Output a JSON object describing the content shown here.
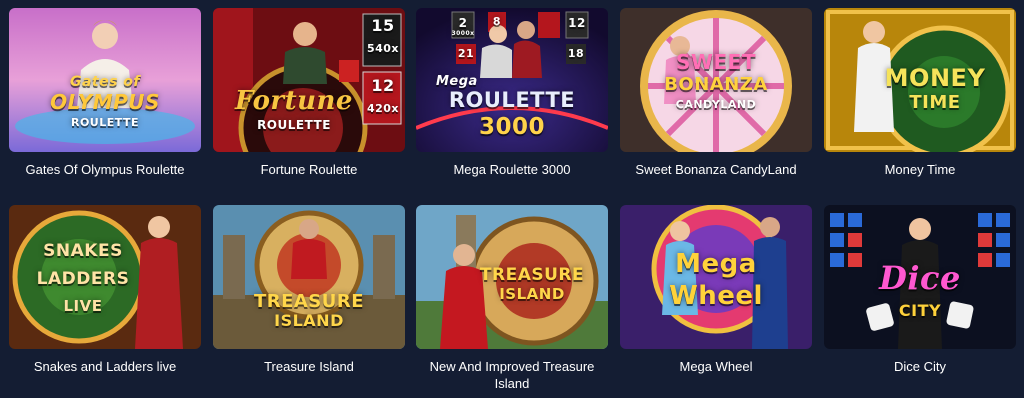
{
  "games": [
    {
      "title": "Gates Of Olympus Roulette",
      "logo": [
        "Gates of",
        "OLYMPUS",
        "ROULETTE"
      ]
    },
    {
      "title": "Fortune Roulette",
      "logo": [
        "Fortune",
        "ROULETTE"
      ],
      "multipliers": [
        "15",
        "540x",
        "12",
        "420x"
      ]
    },
    {
      "title": "Mega Roulette 3000",
      "logo": [
        "Mega",
        "ROULETTE",
        "3000"
      ],
      "numbers": [
        "2",
        "3000x",
        "8",
        "12",
        "21",
        "18"
      ]
    },
    {
      "title": "Sweet Bonanza CandyLand",
      "logo": [
        "SWEET",
        "BONANZA",
        "CANDYLAND"
      ]
    },
    {
      "title": "Money Time",
      "logo": [
        "MONEY",
        "TIME"
      ]
    },
    {
      "title": "Snakes and Ladders live",
      "logo": [
        "SNAKES",
        "LADDERS",
        "LIVE"
      ]
    },
    {
      "title": "Treasure Island",
      "logo": [
        "TREASURE",
        "ISLAND"
      ]
    },
    {
      "title": "New And Improved Treasure Island",
      "logo": [
        "TREASURE",
        "ISLAND"
      ]
    },
    {
      "title": "Mega Wheel",
      "logo": [
        "Mega",
        "Wheel"
      ]
    },
    {
      "title": "Dice City",
      "logo": [
        "Dice",
        "CITY"
      ]
    }
  ],
  "colors": {
    "background": "#141d33",
    "caption": "#ffffff"
  }
}
